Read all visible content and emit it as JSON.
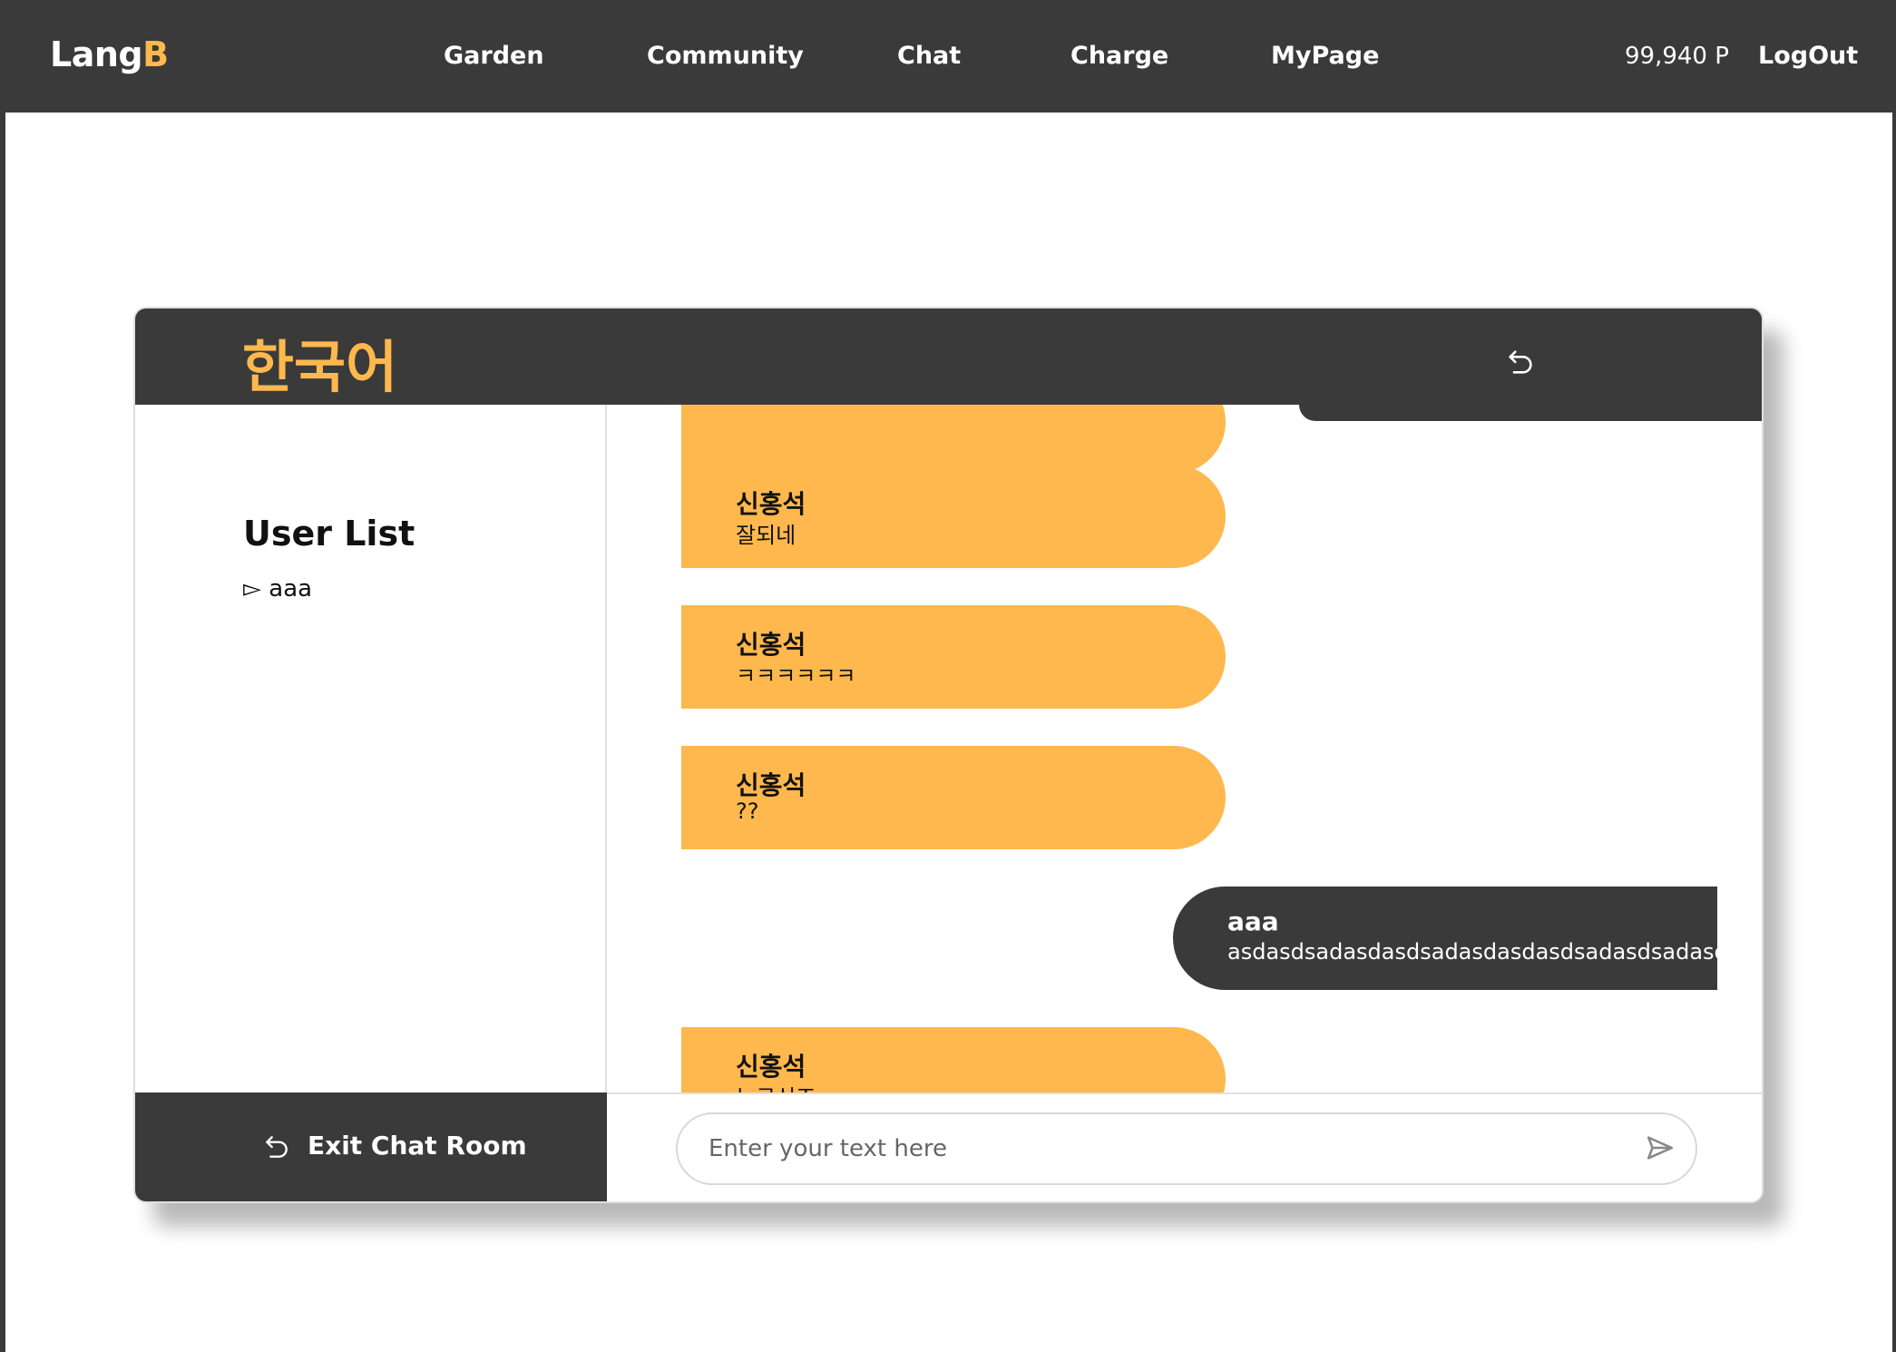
{
  "nav": {
    "logo_main": "Lang",
    "logo_accent": "B",
    "items": [
      "Garden",
      "Community",
      "Chat",
      "Charge",
      "MyPage"
    ],
    "points": "99,940 P",
    "logout": "LogOut"
  },
  "chat": {
    "language_title": "한국어",
    "user_list_title": "User List",
    "users": [
      "▻ aaa"
    ],
    "exit_label": "Exit Chat Room",
    "input_placeholder": "Enter your text here",
    "messages": [
      {
        "side": "other",
        "sender": "신홍석",
        "text": "잘되네"
      },
      {
        "side": "other",
        "sender": "신홍석",
        "text": "ㅋㅋㅋㅋㅋㅋ"
      },
      {
        "side": "other",
        "sender": "신홍석",
        "text": "??"
      },
      {
        "side": "mine",
        "sender": "aaa",
        "text": "asdasdsadasdasdsadasdasdasdsadasdsadasdasdasdsadasdsad"
      },
      {
        "side": "other",
        "sender": "신홍석",
        "text": "누구신죠"
      }
    ]
  },
  "colors": {
    "dark": "#3a3a3a",
    "accent": "#ffb84d",
    "white": "#ffffff"
  },
  "icons": {
    "header_back": "return-arrow-icon",
    "exit": "return-arrow-icon",
    "send": "send-icon",
    "user_bullet": "triangle-bullet-icon"
  }
}
